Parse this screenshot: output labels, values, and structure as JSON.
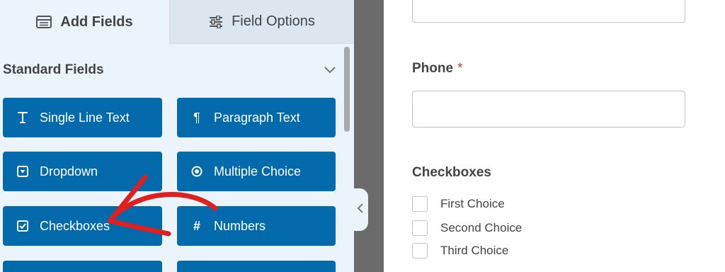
{
  "tabs": {
    "add_fields": "Add Fields",
    "field_options": "Field Options"
  },
  "standard_fields": {
    "title": "Standard Fields",
    "buttons": [
      {
        "label": "Single Line Text",
        "icon": "text-icon"
      },
      {
        "label": "Paragraph Text",
        "icon": "paragraph-icon"
      },
      {
        "label": "Dropdown",
        "icon": "dropdown-icon"
      },
      {
        "label": "Multiple Choice",
        "icon": "radio-icon"
      },
      {
        "label": "Checkboxes",
        "icon": "checkbox-icon"
      },
      {
        "label": "Numbers",
        "icon": "hash-icon"
      }
    ]
  },
  "form": {
    "phone_label": "Phone",
    "required_marker": "*",
    "checkboxes_label": "Checkboxes",
    "choices": [
      "First Choice",
      "Second Choice",
      "Third Choice"
    ]
  },
  "colors": {
    "button_blue": "#036aab",
    "panel_bg": "#ebf3fb",
    "annotation_red": "#e02020",
    "required_red": "#d63638"
  }
}
